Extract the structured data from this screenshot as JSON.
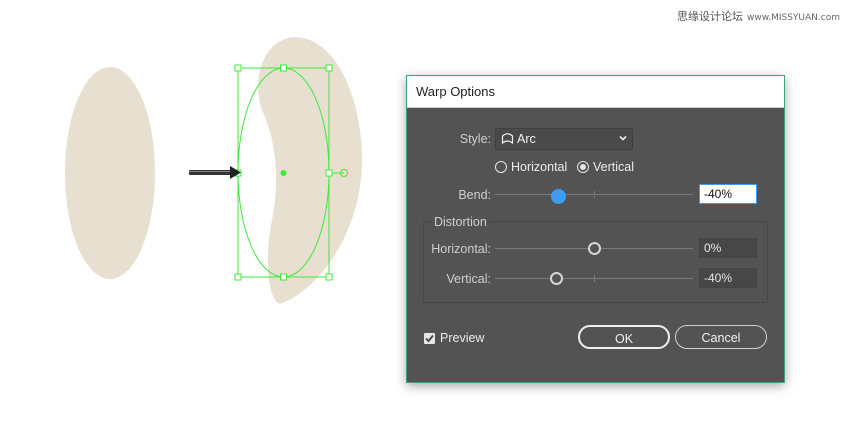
{
  "watermark": {
    "text": "思缘设计论坛",
    "site": "www.MISSYUAN.com"
  },
  "colors": {
    "shape_fill": "#e7dfd0",
    "selection": "#3fe83f",
    "accent": "#3d9cf0",
    "dialog_bg": "#535353"
  },
  "dialog": {
    "title": "Warp Options",
    "style_label": "Style:",
    "style_value": "Arc",
    "style_icon": "arc-warp-icon",
    "orientation": {
      "horizontal_label": "Horizontal",
      "vertical_label": "Vertical",
      "selected": "Vertical"
    },
    "bend": {
      "label": "Bend:",
      "value": "-40%",
      "fraction": 0.3
    },
    "distortion": {
      "title": "Distortion",
      "horizontal": {
        "label": "Horizontal:",
        "value": "0%",
        "fraction": 0.5
      },
      "vertical": {
        "label": "Vertical:",
        "value": "-40%",
        "fraction": 0.3
      }
    },
    "preview_label": "Preview",
    "preview_checked": true,
    "ok_label": "OK",
    "cancel_label": "Cancel"
  }
}
